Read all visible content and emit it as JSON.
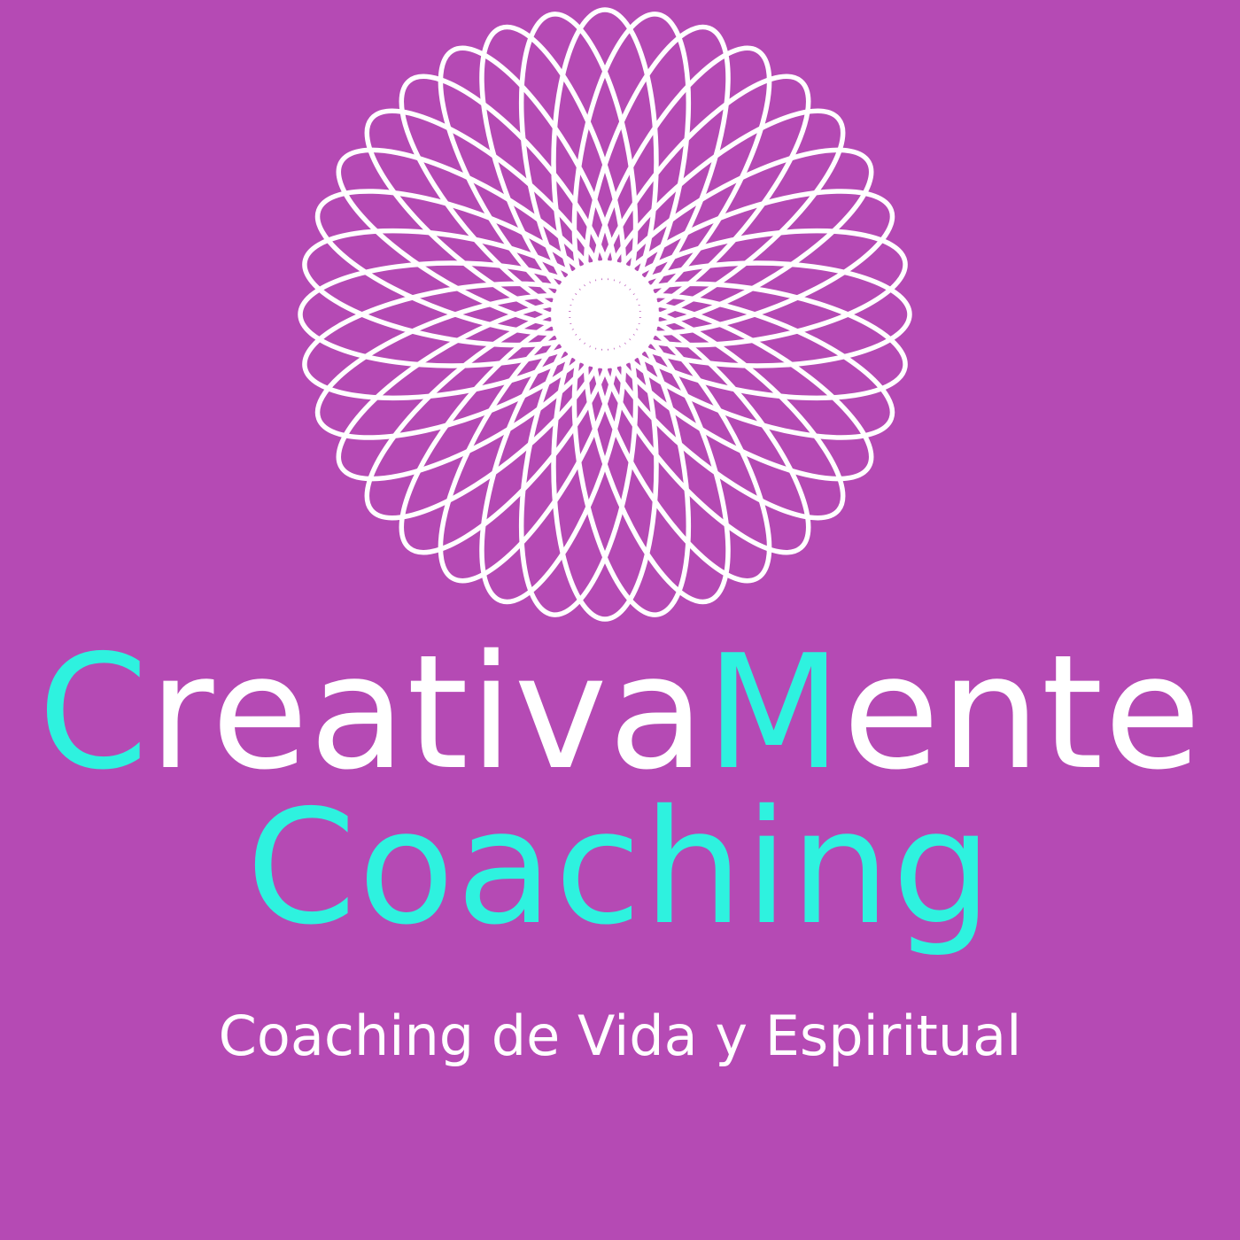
{
  "brand": {
    "line1_initial": "C",
    "line1_part": "reativa",
    "line1_initial2": "M",
    "line1_part2": "ente",
    "line2": "Coaching"
  },
  "tagline": "Coaching de Vida y Espiritual",
  "colors": {
    "background": "#b54ab4",
    "accent": "#2ef2df",
    "text": "#ffffff",
    "mandala_stroke": "#ffffff"
  },
  "icons": {
    "logo": "spirograph-mandala-icon"
  },
  "mandala": {
    "petal_count": 36
  }
}
